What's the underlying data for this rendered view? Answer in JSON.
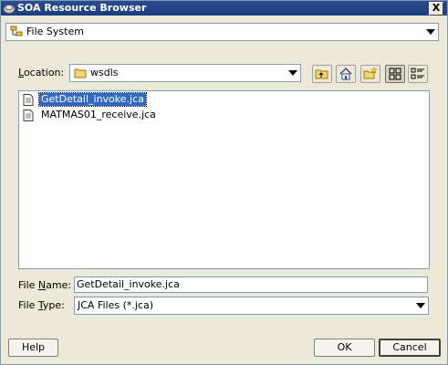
{
  "window": {
    "title": "SOA Resource Browser",
    "close_label": "X"
  },
  "source_combo": {
    "value": "File System",
    "icon": "file-system-icon"
  },
  "location": {
    "label_prefix": "",
    "label_mnemonic": "L",
    "label_rest": "ocation:",
    "value": "wsdls",
    "icon": "folder-icon"
  },
  "toolbar": {
    "buttons": [
      "up-one-level-icon",
      "home-icon",
      "new-folder-icon",
      "list-view-icon",
      "details-view-icon"
    ]
  },
  "files": [
    {
      "name": "GetDetail_invoke.jca",
      "selected": true
    },
    {
      "name": "MATMAS01_receive.jca",
      "selected": false
    }
  ],
  "file_name": {
    "label_prefix": "File ",
    "label_mnemonic": "N",
    "label_rest": "ame:",
    "value": "GetDetail_invoke.jca"
  },
  "file_type": {
    "label_prefix": "File ",
    "label_mnemonic": "T",
    "label_rest": "ype:",
    "value": "JCA Files (*.jca)"
  },
  "buttons": {
    "help": "Help",
    "ok": "OK",
    "cancel": "Cancel"
  }
}
